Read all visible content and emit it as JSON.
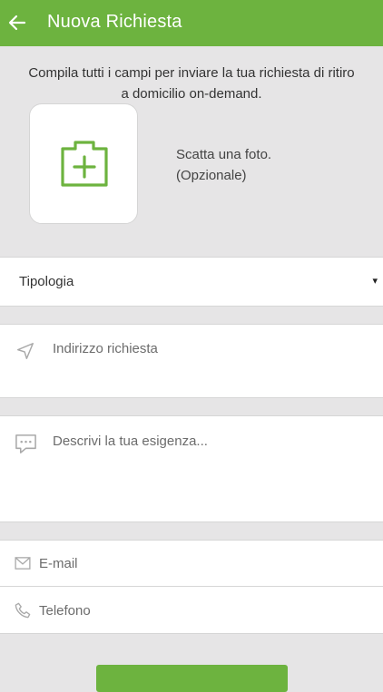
{
  "header": {
    "title": "Nuova Richiesta",
    "accent_color": "#6db33f",
    "back_icon": "arrow-left-icon"
  },
  "intro": {
    "text": "Compila tutti i campi per inviare la tua richiesta di ritiro a domicilio on-demand."
  },
  "photo": {
    "icon": "camera-plus-icon",
    "label_line1": "Scatta una foto.",
    "label_line2": "(Opzionale)"
  },
  "form": {
    "type_select": {
      "value": "Tipologia",
      "arrow": "▾"
    },
    "address": {
      "placeholder": "Indirizzo richiesta",
      "icon": "navigation-arrow-icon"
    },
    "description": {
      "placeholder": "Descrivi la tua esigenza...",
      "icon": "chat-bubble-icon"
    },
    "email": {
      "placeholder": "E-mail",
      "icon": "envelope-icon"
    },
    "phone": {
      "placeholder": "Telefono",
      "icon": "phone-icon"
    }
  },
  "submit": {
    "label": ""
  }
}
